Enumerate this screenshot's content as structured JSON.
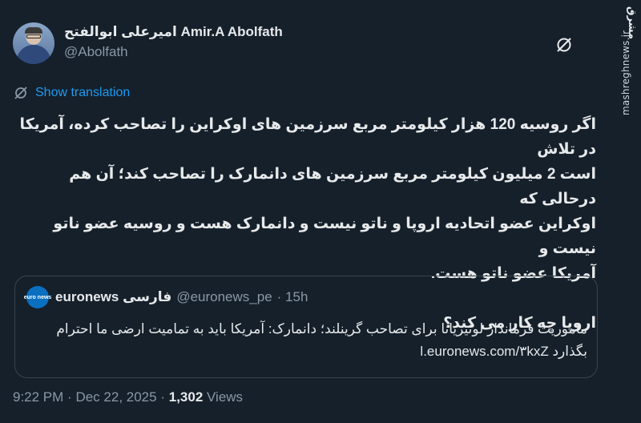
{
  "author": {
    "display_name": "امیرعلی ابوالفتح Amir.A Abolfath",
    "handle": "@Abolfath"
  },
  "translate": {
    "label": "Show translation"
  },
  "tweet": {
    "lines": [
      "اگر روسیه 120 هزار کیلومتر مربع سرزمین های اوکراین را تصاحب کرده، آمریکا در تلاش",
      "است 2 میلیون کیلومتر مربع سرزمین های دانمارک را تصاحب کند؛ آن هم درحالی که",
      "اوکراین عضو اتحادیه اروپا و ناتو نیست و دانمارک هست و روسیه عضو ناتو نیست و",
      "آمریکا عضو ناتو هست."
    ],
    "closing": "اروپا چه کار می کند؟"
  },
  "quote": {
    "logo_text": "euro news",
    "name": "euronews فارسی",
    "handle": "@euronews_pe",
    "time": "· 15h",
    "lines": [
      "ماموریت فرماندار لوئیزیانا برای تصاحب گرینلند؛ دانمارک: آمریکا باید به تمامیت ارضی ما احترام",
      "بگذارد l.euronews.com/۳kxZ"
    ]
  },
  "meta": {
    "time": "9:22 PM",
    "date": "Dec 22, 2025",
    "views_count": "1,302",
    "views_label": "Views",
    "sep": "·"
  },
  "watermark": {
    "logo": "مشرق",
    "site": "mashreghnews.ir"
  },
  "icons": {
    "grok": "grok-icon",
    "translate": "translate-icon"
  },
  "colors": {
    "background": "#15202b",
    "accent": "#1d9bf0",
    "secondary_text": "#8b98a5",
    "border": "#38444d"
  }
}
